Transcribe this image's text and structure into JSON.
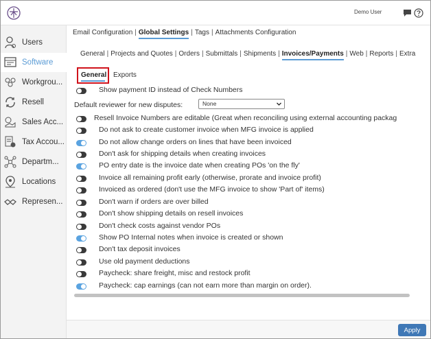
{
  "header": {
    "user_name": "Demo User",
    "icons": [
      "app-logo-icon",
      "chat-icon",
      "help-icon"
    ]
  },
  "sidebar": {
    "items": [
      {
        "label": "Users",
        "icon": "user-icon",
        "active": false
      },
      {
        "label": "Software",
        "icon": "software-icon",
        "active": true
      },
      {
        "label": "Workgrou...",
        "icon": "workgroup-icon",
        "active": false
      },
      {
        "label": "Resell",
        "icon": "resell-icon",
        "active": false
      },
      {
        "label": "Sales Acc...",
        "icon": "sales-account-icon",
        "active": false
      },
      {
        "label": "Tax Accou...",
        "icon": "tax-account-icon",
        "active": false
      },
      {
        "label": "Departm...",
        "icon": "department-icon",
        "active": false
      },
      {
        "label": "Locations",
        "icon": "location-icon",
        "active": false
      },
      {
        "label": "Represen...",
        "icon": "representative-icon",
        "active": false
      }
    ]
  },
  "nav_primary": {
    "tabs": [
      "Email Configuration",
      "Global Settings",
      "Tags",
      "Attachments Configuration"
    ],
    "active": "Global Settings"
  },
  "nav_secondary": {
    "tabs": [
      "General",
      "Projects and Quotes",
      "Orders",
      "Submittals",
      "Shipments",
      "Invoices/Payments",
      "Web",
      "Reports",
      "Extra"
    ],
    "active": "Invoices/Payments"
  },
  "subtabs": {
    "general": "General",
    "exports": "Exports"
  },
  "reviewer": {
    "label": "Default reviewer for new disputes:",
    "selected": "None"
  },
  "settings": [
    {
      "label": "Show payment ID instead of Check Numbers",
      "enabled": false
    },
    {
      "label": "Resell Invoice Numbers are editable (Great when reconciling using external accounting packag",
      "enabled": false
    },
    {
      "label": "Do not ask to create customer invoice when MFG invoice is applied",
      "enabled": false
    },
    {
      "label": "Do not allow change orders on lines that have been invoiced",
      "enabled": true
    },
    {
      "label": "Don't ask for shipping details when creating invoices",
      "enabled": false
    },
    {
      "label": "PO entry date is the invoice date when creating POs 'on the fly'",
      "enabled": true
    },
    {
      "label": "Invoice all remaining profit early (otherwise, prorate and invoice profit)",
      "enabled": false
    },
    {
      "label": "Invoiced as ordered (don't use the MFG invoice to show 'Part of' items)",
      "enabled": false
    },
    {
      "label": "Don't warn if orders are over billed",
      "enabled": false
    },
    {
      "label": "Don't show shipping details on resell invoices",
      "enabled": false
    },
    {
      "label": "Don't check costs against vendor POs",
      "enabled": false
    },
    {
      "label": "Show PO Internal notes when invoice is created or shown",
      "enabled": true
    },
    {
      "label": "Don't tax deposit invoices",
      "enabled": false
    },
    {
      "label": "Use old payment deductions",
      "enabled": false
    },
    {
      "label": "Paycheck: share freight, misc and restock profit",
      "enabled": false
    },
    {
      "label": "Paycheck: cap earnings (can not earn more than margin on order).",
      "enabled": true
    }
  ],
  "footer": {
    "apply_label": "Apply"
  },
  "colors": {
    "accent": "#5a9bd5",
    "toggle_on": "#5aa3e0",
    "toggle_off": "#3a3a3a",
    "highlight_box": "#d0121b",
    "apply_button": "#3f78b6"
  }
}
